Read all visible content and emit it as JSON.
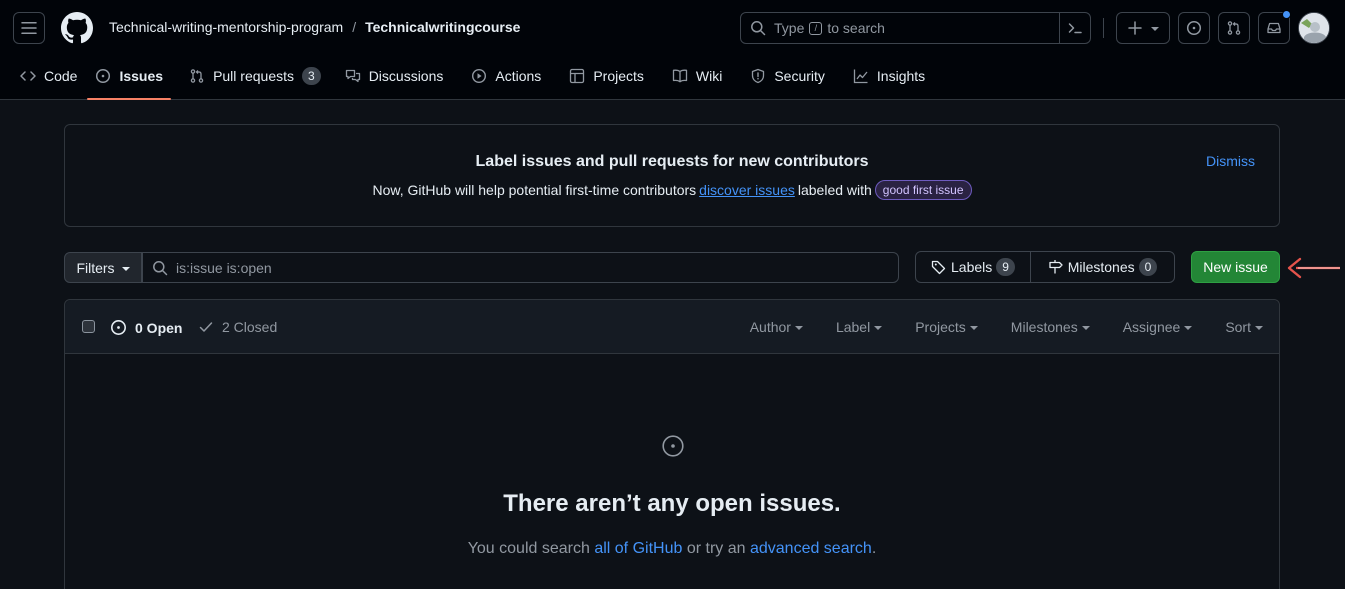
{
  "header": {
    "owner": "Technical-writing-mentorship-program",
    "separator": "/",
    "repo": "Technicalwritingcourse",
    "search": {
      "prefix": "Type",
      "key": "/",
      "suffix": "to search"
    }
  },
  "tabs": [
    {
      "label": "Code",
      "icon": "code-icon"
    },
    {
      "label": "Issues",
      "icon": "issue-opened-icon",
      "active": true
    },
    {
      "label": "Pull requests",
      "icon": "git-pull-request-icon",
      "count": "3"
    },
    {
      "label": "Discussions",
      "icon": "comment-discussion-icon"
    },
    {
      "label": "Actions",
      "icon": "play-icon"
    },
    {
      "label": "Projects",
      "icon": "table-icon"
    },
    {
      "label": "Wiki",
      "icon": "book-icon"
    },
    {
      "label": "Security",
      "icon": "shield-icon"
    },
    {
      "label": "Insights",
      "icon": "graph-icon"
    }
  ],
  "banner": {
    "title": "Label issues and pull requests for new contributors",
    "desc_before": "Now, GitHub will help potential first-time contributors",
    "link": "discover issues",
    "desc_after": "labeled with",
    "label_chip": "good first issue",
    "dismiss": "Dismiss"
  },
  "filters": {
    "button": "Filters",
    "query": "is:issue is:open",
    "labels": "Labels",
    "labels_count": "9",
    "milestones": "Milestones",
    "milestones_count": "0",
    "new_issue": "New issue"
  },
  "list": {
    "open": "0 Open",
    "closed": "2 Closed",
    "sorts": [
      "Author",
      "Label",
      "Projects",
      "Milestones",
      "Assignee",
      "Sort"
    ]
  },
  "empty": {
    "title": "There aren’t any open issues.",
    "desc_before": "You could search",
    "link1": "all of GitHub",
    "desc_mid": "or try an",
    "link2": "advanced search",
    "desc_after": "."
  },
  "colors": {
    "accent": "#4493f8",
    "active_tab_underline": "#f78166",
    "new_issue_bg": "#238636",
    "annotation_arrow": "#e5534b"
  }
}
